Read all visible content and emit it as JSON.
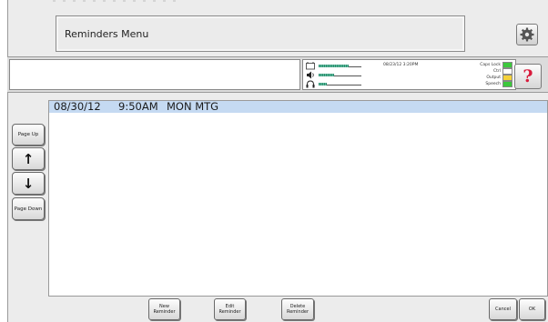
{
  "header": {
    "title": "Reminders Menu"
  },
  "status": {
    "message": "",
    "datetime": "08/23/12 3:20PM",
    "indicators": [
      {
        "label": "Caps Lock",
        "color": "#3cc83c"
      },
      {
        "label": "Ctrl",
        "color": "#ffffff"
      },
      {
        "label": "Output",
        "color": "#f4d13a"
      },
      {
        "label": "Speech",
        "color": "#3cc83c"
      }
    ],
    "meters": [
      {
        "icon": "keyboard-icon",
        "level": 0.75
      },
      {
        "icon": "speaker-icon",
        "level": 0.4
      },
      {
        "icon": "headphones-icon",
        "level": 0.2
      }
    ],
    "help_label": "?"
  },
  "nav": {
    "page_up": "Page Up",
    "up_arrow": "↑",
    "down_arrow": "↓",
    "page_down": "Page Down"
  },
  "reminders": [
    {
      "date": "08/30/12",
      "time": "9:50AM",
      "text": "MON MTG"
    }
  ],
  "actions": {
    "new": "New Reminder",
    "edit": "Edit Reminder",
    "delete": "Delete Reminder",
    "cancel": "Cancel",
    "ok": "OK"
  },
  "colors": {
    "selection": "#c5daf2",
    "help": "#d81b3c",
    "meter": "#5fc0a0"
  }
}
